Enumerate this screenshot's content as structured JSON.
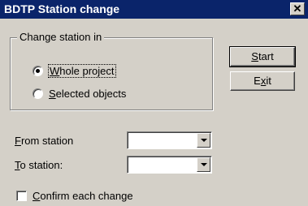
{
  "window": {
    "title": "BDTP Station change"
  },
  "group": {
    "legend": "Change station in",
    "options": [
      {
        "prefix": "",
        "accel": "W",
        "rest": "hole project",
        "selected": true
      },
      {
        "prefix": "",
        "accel": "S",
        "rest": "elected objects",
        "selected": false
      }
    ]
  },
  "buttons": {
    "start": {
      "prefix": "",
      "accel": "S",
      "rest": "tart"
    },
    "exit": {
      "prefix": "E",
      "accel": "x",
      "rest": "it"
    }
  },
  "fields": {
    "from": {
      "prefix": "",
      "accel": "F",
      "rest": "rom station",
      "value": ""
    },
    "to": {
      "prefix": "",
      "accel": "T",
      "rest": "o station:",
      "value": ""
    }
  },
  "confirm": {
    "prefix": "",
    "accel": "C",
    "rest": "onfirm each change",
    "checked": false
  }
}
